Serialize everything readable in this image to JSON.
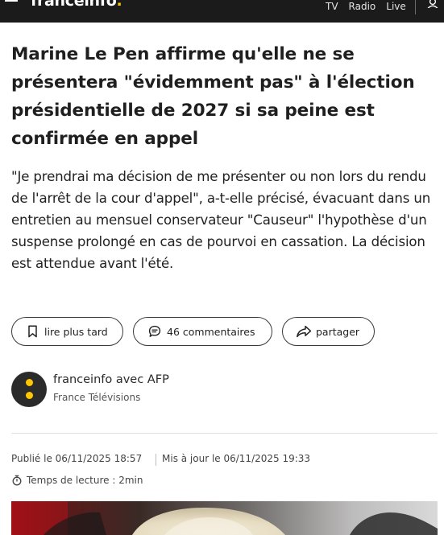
{
  "header": {
    "brand_name": "franceinfo",
    "brand_dot": ".",
    "brand_color": "#1b1b1b",
    "accent_color": "#ffc700",
    "nav": [
      {
        "label": "TV"
      },
      {
        "label": "Radio"
      },
      {
        "label": "Live"
      }
    ],
    "icons": [
      "menu-icon",
      "user-icon"
    ]
  },
  "article": {
    "title": "Marine Le Pen affirme qu'elle ne se présentera \"évidemment pas\" à l'élection présidentielle de 2027 si sa peine est confirmée en appel",
    "lead": "\"Je prendrai ma décision de me présenter ou non lors du rendu de l'arrêt de la cour d'appel\", a-t-elle précisé, évacuant dans un entretien au mensuel conservateur \"Causeur\" l'hypothèse d'un suspense prolongé en cas de pourvoi en cassation. La décision est attendue avant l'été.",
    "actions": {
      "save_label": "lire plus tard",
      "comments_label": "46 commentaires",
      "share_label": "partager",
      "icons": [
        "bookmark-icon",
        "comment-icon",
        "share-icon"
      ]
    },
    "author": {
      "name": "franceinfo avec AFP",
      "organization": "France Télévisions"
    },
    "published": "Publié le 06/11/2025 18:57",
    "updated": "Mis à jour le 06/11/2025 19:33",
    "reading_time": "Temps de lecture : 2min",
    "reading_icon": "stopwatch-icon"
  }
}
